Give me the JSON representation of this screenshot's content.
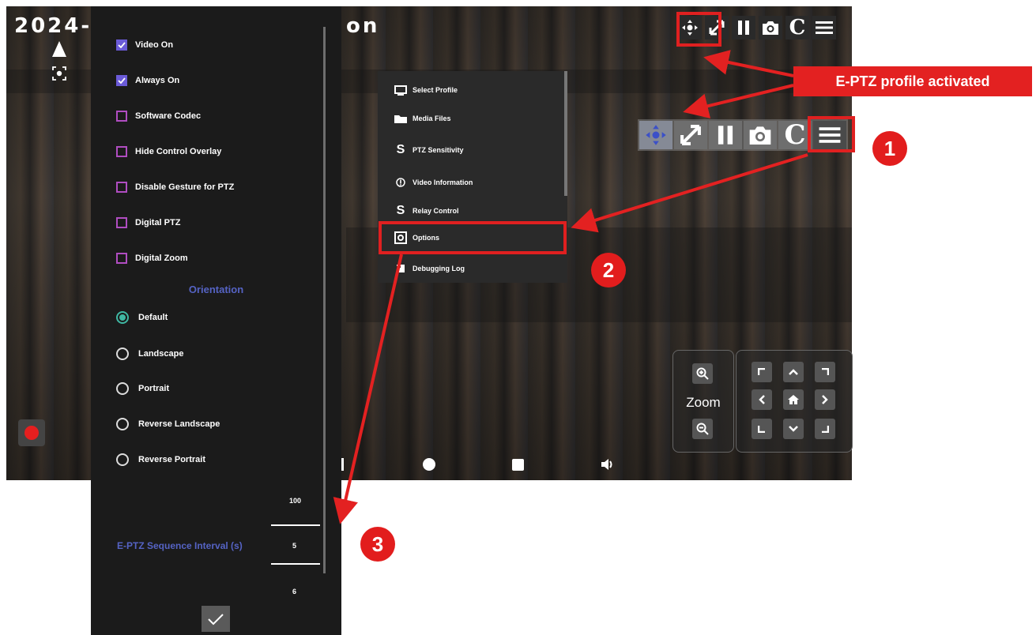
{
  "camera": {
    "title_start": "2024-",
    "title_end": "on"
  },
  "toolbar_top": {
    "buttons": [
      "move-icon",
      "ptz-arrow-icon",
      "pause-icon",
      "camera-icon",
      "C",
      "menu-icon"
    ],
    "c_label": "C"
  },
  "toolbar_mid": {
    "c_label": "C"
  },
  "context_menu": {
    "items": [
      {
        "icon": "monitor-icon",
        "label": "Select Profile"
      },
      {
        "icon": "folder-icon",
        "label": "Media Files"
      },
      {
        "icon": "S",
        "label": "PTZ Sensitivity"
      },
      {
        "icon": "info-icon",
        "label": "Video Information"
      },
      {
        "icon": "S",
        "label": "Relay Control"
      },
      {
        "icon": "gear-icon",
        "label": "Options"
      },
      {
        "icon": "log-icon",
        "label": "Debugging Log"
      }
    ]
  },
  "options": {
    "checkboxes": [
      {
        "label": "Video On",
        "checked": true
      },
      {
        "label": "Always On",
        "checked": true
      },
      {
        "label": "Software Codec",
        "checked": false
      },
      {
        "label": "Hide Control Overlay",
        "checked": false
      },
      {
        "label": "Disable Gesture for PTZ",
        "checked": false
      },
      {
        "label": "Digital PTZ",
        "checked": false
      },
      {
        "label": "Digital Zoom",
        "checked": false
      }
    ],
    "orientation_heading": "Orientation",
    "orientations": [
      {
        "label": "Default",
        "selected": true
      },
      {
        "label": "Landscape",
        "selected": false
      },
      {
        "label": "Portrait",
        "selected": false
      },
      {
        "label": "Reverse Landscape",
        "selected": false
      },
      {
        "label": "Reverse Portrait",
        "selected": false
      }
    ],
    "eptz_label": "E-PTZ  Sequence Interval (s)",
    "picker": {
      "above": "100",
      "selected": "5",
      "below": "6"
    }
  },
  "zoom": {
    "label": "Zoom"
  },
  "annotations": {
    "banner": "E-PTZ profile activated",
    "badge1": "1",
    "badge2": "2",
    "badge3": "3",
    "color": "#e32121"
  }
}
